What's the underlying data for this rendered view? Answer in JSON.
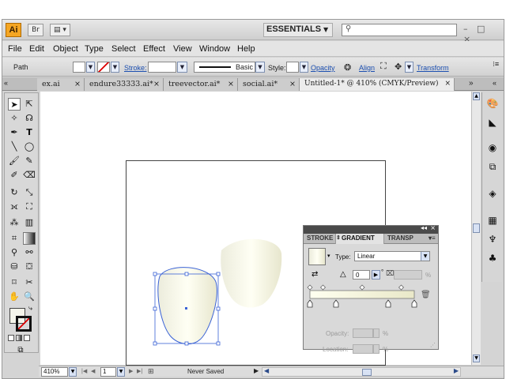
{
  "app": {
    "logo": "Ai",
    "bridge": "Br",
    "workspace": "ESSENTIALS",
    "search_placeholder": "",
    "window_controls": "– □ ×"
  },
  "menu": [
    "File",
    "Edit",
    "Object",
    "Type",
    "Select",
    "Effect",
    "View",
    "Window",
    "Help"
  ],
  "control": {
    "selection_label": "Path",
    "stroke_label": "Stroke:",
    "brush_label": "Basic",
    "style_label": "Style:",
    "opacity_link": "Opacity",
    "align_link": "Align",
    "transform_link": "Transform"
  },
  "tabs": [
    {
      "label": "ex.ai",
      "close": "×"
    },
    {
      "label": "endure33333.ai*",
      "close": "×"
    },
    {
      "label": "treevector.ai*",
      "close": "×"
    },
    {
      "label": "social.ai*",
      "close": "×"
    },
    {
      "label": "Untitled-1* @ 410% (CMYK/Preview)",
      "close": "×"
    }
  ],
  "tabs_overflow": "»",
  "gradient_panel": {
    "tabs": [
      "STROKE",
      "GRADIENT",
      "TRANSP"
    ],
    "type_label": "Type:",
    "type_value": "Linear",
    "angle_value": "0",
    "angle_unit": "°",
    "opacity_label": "Opacity:",
    "location_label": "Location:",
    "percent": "%",
    "stops": [
      0,
      0.25,
      0.75,
      1.0
    ]
  },
  "status": {
    "zoom": "410%",
    "page": "1",
    "save_state": "Never Saved"
  },
  "colors": {
    "accent_logo": "#f5a623",
    "link": "#1c4fb0",
    "selection": "#3a62d6"
  }
}
